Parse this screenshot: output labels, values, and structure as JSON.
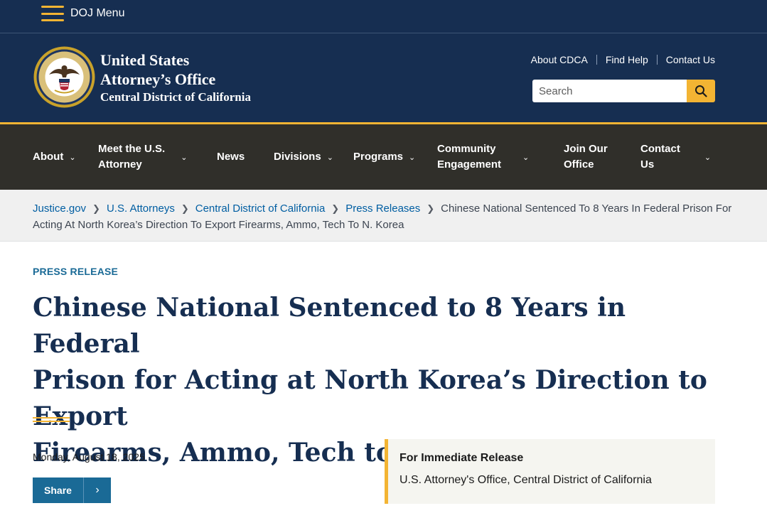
{
  "topbar": {
    "menu_label": "DOJ Menu"
  },
  "header": {
    "title_line1": "United States",
    "title_line2": "Attorney’s Office",
    "title_line3": "Central District of California",
    "seal_icon": "doj-seal-icon",
    "utility_links": [
      "About CDCA",
      "Find Help",
      "Contact Us"
    ],
    "search": {
      "placeholder": "Search",
      "value": ""
    },
    "colors": {
      "navy": "#162e51",
      "gold": "#f3b433"
    }
  },
  "nav": {
    "items": [
      {
        "label_line1": "About",
        "label_line2": "",
        "has_chevron": true
      },
      {
        "label_line1": "Meet the U.S.",
        "label_line2": "Attorney",
        "has_chevron": true
      },
      {
        "label_line1": "News",
        "label_line2": "",
        "has_chevron": false
      },
      {
        "label_line1": "Divisions",
        "label_line2": "",
        "has_chevron": true
      },
      {
        "label_line1": "Programs",
        "label_line2": "",
        "has_chevron": true
      },
      {
        "label_line1": "Community",
        "label_line2": "Engagement",
        "has_chevron": true
      },
      {
        "label_line1": "Join Our",
        "label_line2": "Office",
        "has_chevron": false
      },
      {
        "label_line1": "Contact",
        "label_line2": "Us",
        "has_chevron": true
      }
    ],
    "colors": {
      "background": "#302f2a"
    }
  },
  "breadcrumb": {
    "links": [
      "Justice.gov",
      "U.S. Attorneys",
      "Central District of California",
      "Press Releases"
    ],
    "current": "Chinese National Sentenced To 8 Years In Federal Prison For Acting At North Korea’s Direction To Export Firearms, Ammo, Tech To N. Korea"
  },
  "article": {
    "eyebrow": "PRESS RELEASE",
    "headline_line1": "Chinese National Sentenced to 8 Years in Federal",
    "headline_line2": "Prison for Acting at North Korea’s Direction to Export",
    "headline_line3": "Firearms, Ammo, Tech to N. Korea",
    "date": "Monday, August 18, 2025",
    "share_label": "Share",
    "release_box": {
      "heading": "For Immediate Release",
      "body": "U.S. Attorney's Office, Central District of California"
    }
  }
}
